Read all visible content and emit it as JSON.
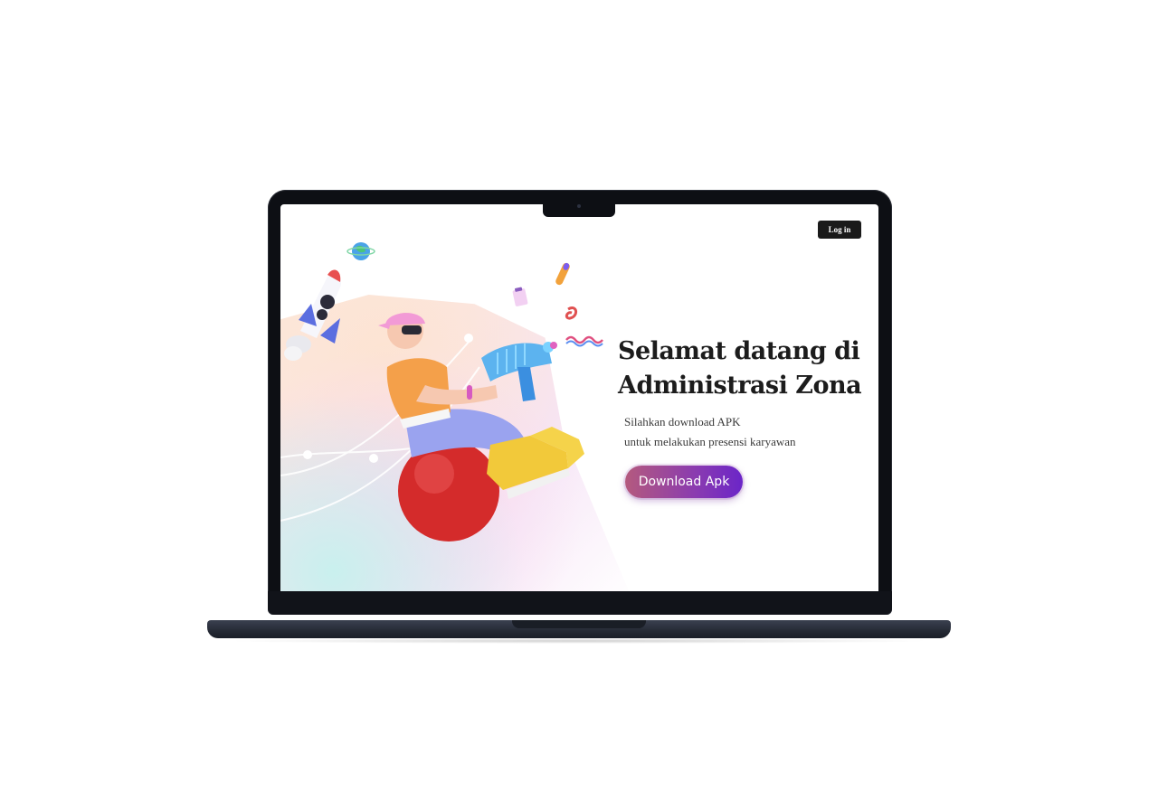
{
  "screen": {
    "login_label": "Log in",
    "headline_line1": "Selamat datang di",
    "headline_line2": "Administrasi Zona",
    "sub_line1": "Silahkan download APK",
    "sub_line2": "untuk melakukan presensi karyawan",
    "download_label": "Download Apk"
  },
  "colors": {
    "bezel": "#0d0f14",
    "base": "#2a2f3b",
    "button_dark": "#1a1a1a",
    "gradient_start": "#b45a7e",
    "gradient_end": "#6b25c8"
  },
  "icons": {
    "illustration": "3d-character-on-ball-with-water-gun",
    "rocket": "rocket-icon",
    "globe": "globe-icon",
    "camera": "camera-notch"
  }
}
